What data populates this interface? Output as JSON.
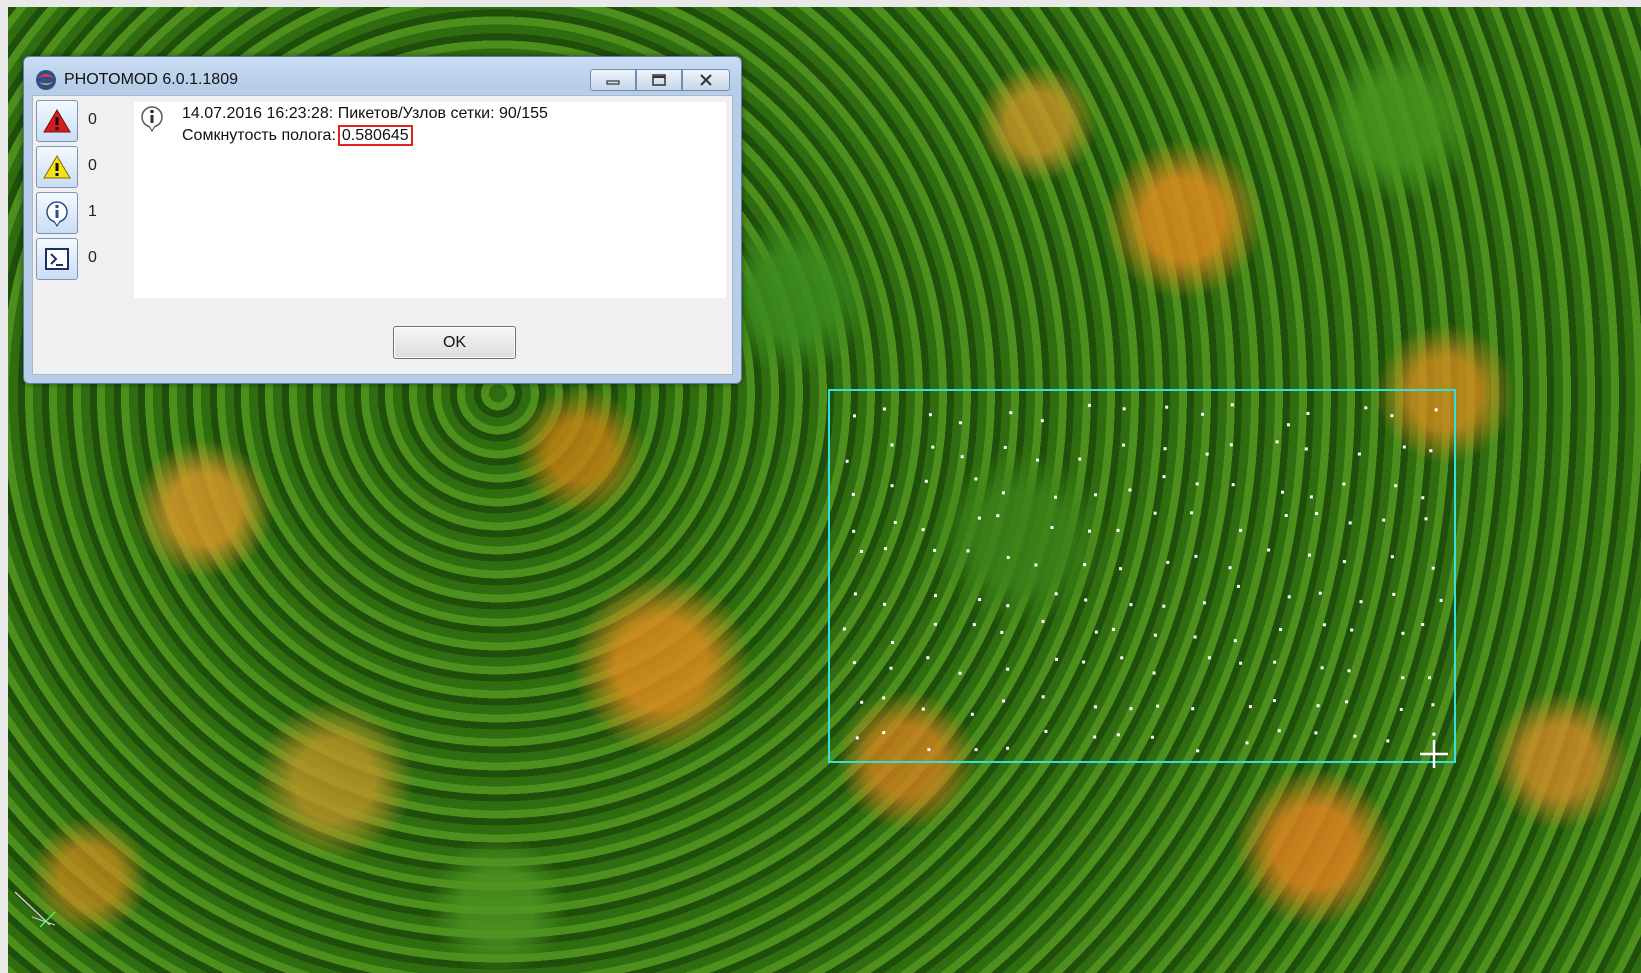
{
  "window": {
    "title": "PHOTOMOD 6.0.1.1809",
    "logo_icon": "photomod-logo-icon",
    "minimize_icon": "minimize-icon",
    "maximize_icon": "maximize-icon",
    "close_icon": "close-icon"
  },
  "counters": [
    {
      "name": "errors",
      "icon": "error-icon",
      "value": "0"
    },
    {
      "name": "warnings",
      "icon": "warning-icon",
      "value": "0"
    },
    {
      "name": "info",
      "icon": "info-icon",
      "value": "1"
    },
    {
      "name": "console",
      "icon": "console-icon",
      "value": "0"
    }
  ],
  "log": {
    "icon": "info-icon",
    "line1": "14.07.2016 16:23:28: Пикетов/Узлов сетки: 90/155",
    "line2_label": "Сомкнутость полога:",
    "line2_value": "0.580645",
    "highlight_color": "#e32222"
  },
  "dialog": {
    "ok_label": "OK"
  },
  "map": {
    "selection_color": "#34e0d8",
    "point_color": "#ffffff",
    "cursor_icon": "crosshair-cursor-icon",
    "axis_icon": "axis-indicator-icon"
  }
}
